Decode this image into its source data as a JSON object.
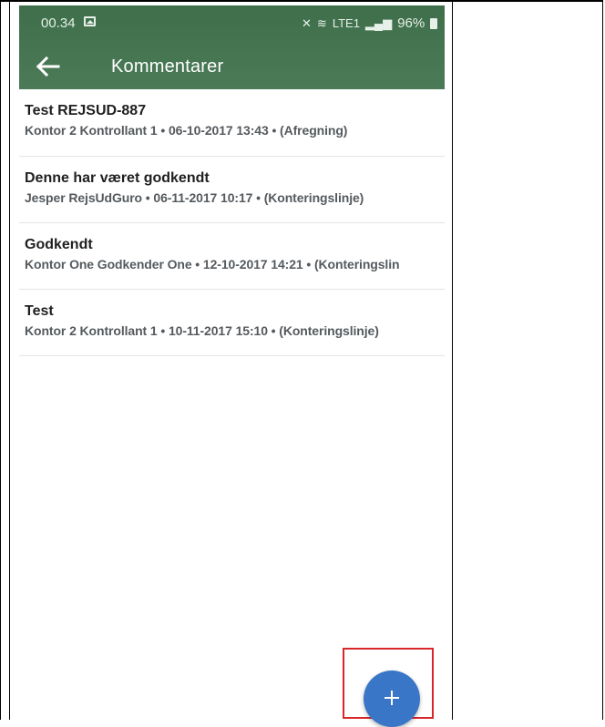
{
  "status_bar": {
    "time": "00.34",
    "network": "LTE1",
    "battery": "96%"
  },
  "app_bar": {
    "title": "Kommentarer",
    "back_icon": "arrow-left-icon"
  },
  "comments": [
    {
      "title": "Test REJSUD-887",
      "meta": "Kontor 2 Kontrollant 1 • 06-10-2017 13:43 • (Afregning)"
    },
    {
      "title": "Denne har været godkendt",
      "meta": "Jesper RejsUdGuro • 06-11-2017 10:17 • (Konteringslinje)"
    },
    {
      "title": "Godkendt",
      "meta": "Kontor One Godkender One • 12-10-2017 14:21 • (Konteringslin"
    },
    {
      "title": "Test",
      "meta": "Kontor 2 Kontrollant 1 • 10-11-2017 15:10 • (Konteringslinje)"
    }
  ],
  "fab": {
    "icon": "plus-icon"
  },
  "colors": {
    "app_bar": "#4b7a57",
    "fab": "#3a76c7",
    "highlight": "#d9262b"
  }
}
